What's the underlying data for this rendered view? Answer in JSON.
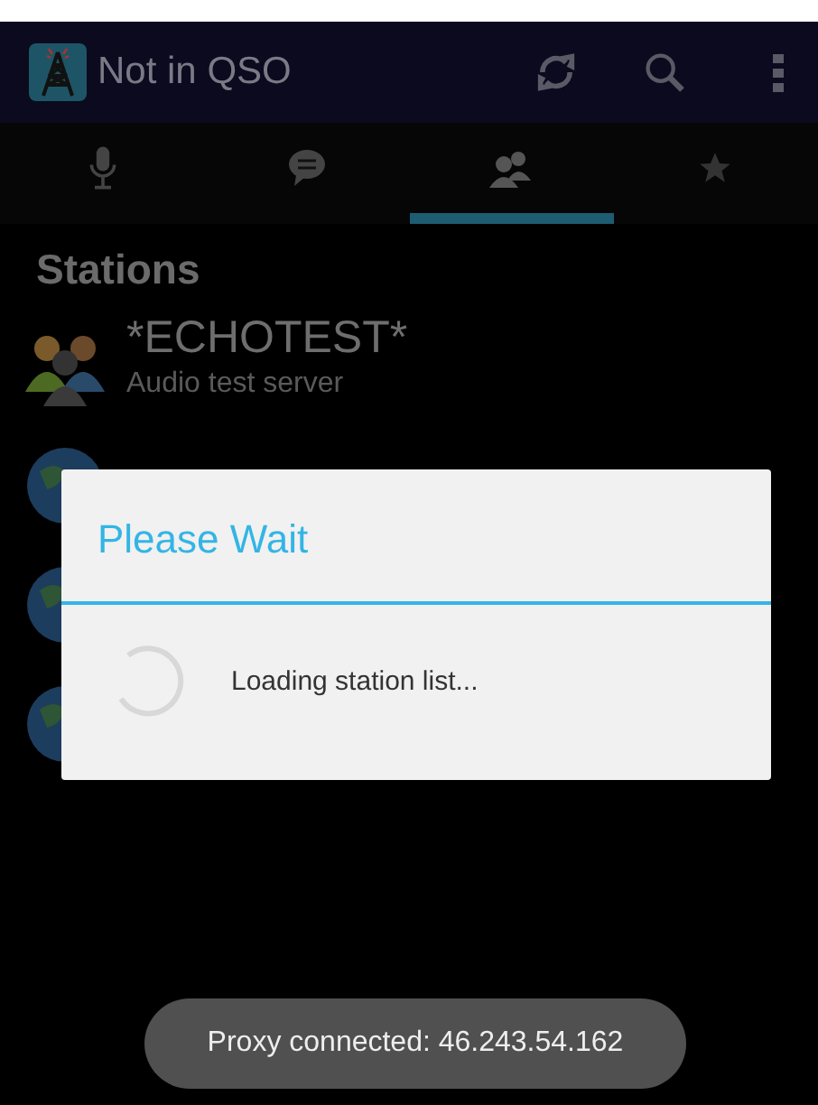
{
  "action_bar": {
    "title": "Not in QSO"
  },
  "tabs": [
    {
      "kind": "microphone",
      "selected": false
    },
    {
      "kind": "chat",
      "selected": false
    },
    {
      "kind": "people",
      "selected": true
    },
    {
      "kind": "star",
      "selected": false
    }
  ],
  "section_title": "Stations",
  "stations": [
    {
      "kind": "people",
      "name": "*ECHOTEST*",
      "description": "Audio test server"
    },
    {
      "kind": "globe"
    },
    {
      "kind": "globe"
    },
    {
      "kind": "globe"
    }
  ],
  "dialog": {
    "title": "Please Wait",
    "message": "Loading station list..."
  },
  "toast": "Proxy connected: 46.243.54.162"
}
